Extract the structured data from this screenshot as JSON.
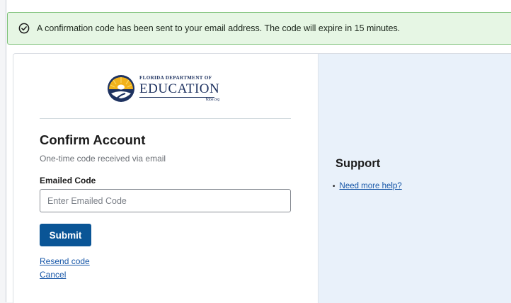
{
  "alert": {
    "message": "A confirmation code has been sent to your email address. The code will expire in 15 minutes.",
    "icon": "check-circle-icon",
    "color": "#e6f6e4"
  },
  "logo": {
    "top_text": "FLORIDA DEPARTMENT OF",
    "main_text": "EDUCATION",
    "url_text": "fldoe.org"
  },
  "form": {
    "title": "Confirm Account",
    "subtitle": "One-time code received via email",
    "field_label": "Emailed Code",
    "field_placeholder": "Enter Emailed Code",
    "field_value": "",
    "submit_label": "Submit",
    "resend_label": "Resend code",
    "cancel_label": "Cancel"
  },
  "support": {
    "title": "Support",
    "links": [
      {
        "label": "Need more help?"
      }
    ]
  },
  "colors": {
    "primary": "#0a5596",
    "link": "#1757a8",
    "alert_border": "#7fc27a",
    "support_panel": "#e9f1fa"
  }
}
